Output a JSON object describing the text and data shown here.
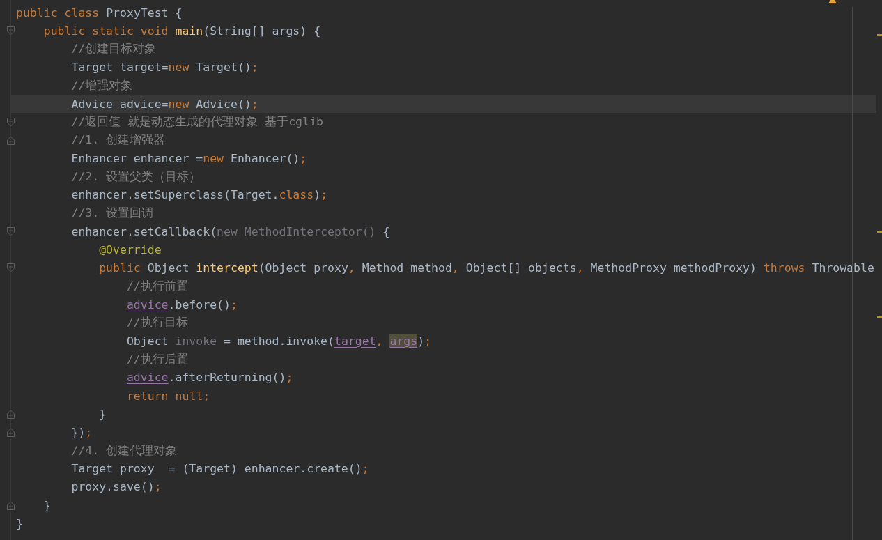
{
  "editor": {
    "lines": [
      {
        "kind": "line",
        "current": false,
        "tokens": [
          {
            "kind": "keyword",
            "text": "public class "
          },
          {
            "kind": "plain",
            "text": "ProxyTest {"
          }
        ],
        "children": [
          {
            "kind": "fold_start",
            "current": false,
            "tokens": [
              {
                "kind": "keyword",
                "text": "public static void "
              },
              {
                "kind": "method",
                "text": "main"
              },
              {
                "kind": "plain",
                "text": "(String[] args) {"
              }
            ],
            "children": [
              {
                "kind": "line",
                "current": false,
                "tokens": [
                  {
                    "kind": "comment",
                    "text": "//创建目标对象"
                  }
                ]
              },
              {
                "kind": "line",
                "current": false,
                "tokens": [
                  {
                    "kind": "plain",
                    "text": "Target target="
                  },
                  {
                    "kind": "keyword",
                    "text": "new "
                  },
                  {
                    "kind": "plain",
                    "text": "Target()"
                  },
                  {
                    "kind": "keyword",
                    "text": ";"
                  }
                ]
              },
              {
                "kind": "line",
                "current": false,
                "tokens": [
                  {
                    "kind": "comment",
                    "text": "//增强对象"
                  }
                ]
              },
              {
                "kind": "line",
                "current": true,
                "tokens": [
                  {
                    "kind": "plain",
                    "text": "Advice advice="
                  },
                  {
                    "kind": "keyword",
                    "text": "new "
                  },
                  {
                    "kind": "plain",
                    "text": "Advice()"
                  },
                  {
                    "kind": "keyword",
                    "text": ";"
                  }
                ]
              },
              {
                "kind": "fold_start",
                "current": false,
                "tokens": [
                  {
                    "kind": "comment",
                    "text": "//返回值 就是动态生成的代理对象 基于cglib"
                  }
                ]
              },
              {
                "kind": "fold_end",
                "current": false,
                "tokens": [
                  {
                    "kind": "comment",
                    "text": "//1. 创建增强器"
                  }
                ]
              },
              {
                "kind": "line",
                "current": false,
                "tokens": [
                  {
                    "kind": "plain",
                    "text": "Enhancer enhancer ="
                  },
                  {
                    "kind": "keyword",
                    "text": "new "
                  },
                  {
                    "kind": "plain",
                    "text": "Enhancer()"
                  },
                  {
                    "kind": "keyword",
                    "text": ";"
                  }
                ]
              },
              {
                "kind": "line",
                "current": false,
                "tokens": [
                  {
                    "kind": "comment",
                    "text": "//2. 设置父类（目标）"
                  }
                ]
              },
              {
                "kind": "line",
                "current": false,
                "tokens": [
                  {
                    "kind": "plain",
                    "text": "enhancer.setSuperclass(Target."
                  },
                  {
                    "kind": "keyword",
                    "text": "class"
                  },
                  {
                    "kind": "plain",
                    "text": ")"
                  },
                  {
                    "kind": "keyword",
                    "text": ";"
                  }
                ]
              },
              {
                "kind": "line",
                "current": false,
                "tokens": [
                  {
                    "kind": "comment",
                    "text": "//3. 设置回调"
                  }
                ]
              },
              {
                "kind": "fold_start",
                "current": false,
                "tokens": [
                  {
                    "kind": "plain",
                    "text": "enhancer.setCallback("
                  },
                  {
                    "kind": "unused",
                    "text": "new MethodInterceptor()"
                  },
                  {
                    "kind": "plain",
                    "text": " {"
                  }
                ],
                "children": [
                  {
                    "kind": "line",
                    "current": false,
                    "tokens": [
                      {
                        "kind": "annotation",
                        "text": "@Override"
                      }
                    ]
                  },
                  {
                    "kind": "fold_start",
                    "current": false,
                    "tokens": [
                      {
                        "kind": "keyword",
                        "text": "public "
                      },
                      {
                        "kind": "plain",
                        "text": "Object "
                      },
                      {
                        "kind": "method",
                        "text": "intercept"
                      },
                      {
                        "kind": "plain",
                        "text": "(Object proxy"
                      },
                      {
                        "kind": "keyword",
                        "text": ", "
                      },
                      {
                        "kind": "plain",
                        "text": "Method method"
                      },
                      {
                        "kind": "keyword",
                        "text": ", "
                      },
                      {
                        "kind": "plain",
                        "text": "Object[] objects"
                      },
                      {
                        "kind": "keyword",
                        "text": ", "
                      },
                      {
                        "kind": "plain",
                        "text": "MethodProxy methodProxy) "
                      },
                      {
                        "kind": "keyword",
                        "text": "throws "
                      },
                      {
                        "kind": "plain",
                        "text": "Throwable"
                      }
                    ],
                    "children": [
                      {
                        "kind": "line",
                        "current": false,
                        "tokens": [
                          {
                            "kind": "comment",
                            "text": "//执行前置"
                          }
                        ]
                      },
                      {
                        "kind": "line",
                        "current": false,
                        "tokens": [
                          {
                            "kind": "field",
                            "text": "advice"
                          },
                          {
                            "kind": "plain",
                            "text": ".before()"
                          },
                          {
                            "kind": "keyword",
                            "text": ";"
                          }
                        ]
                      },
                      {
                        "kind": "line",
                        "current": false,
                        "tokens": [
                          {
                            "kind": "comment",
                            "text": "//执行目标"
                          }
                        ]
                      },
                      {
                        "kind": "line",
                        "current": false,
                        "tokens": [
                          {
                            "kind": "plain",
                            "text": "Object "
                          },
                          {
                            "kind": "unused",
                            "text": "invoke"
                          },
                          {
                            "kind": "plain",
                            "text": " = method.invoke("
                          },
                          {
                            "kind": "field",
                            "text": "target"
                          },
                          {
                            "kind": "keyword",
                            "text": ", "
                          },
                          {
                            "kind": "field_highlight",
                            "text": "args"
                          },
                          {
                            "kind": "plain",
                            "text": ")"
                          },
                          {
                            "kind": "keyword",
                            "text": ";"
                          }
                        ]
                      },
                      {
                        "kind": "line",
                        "current": false,
                        "tokens": [
                          {
                            "kind": "comment",
                            "text": "//执行后置"
                          }
                        ]
                      },
                      {
                        "kind": "line",
                        "current": false,
                        "tokens": [
                          {
                            "kind": "field",
                            "text": "advice"
                          },
                          {
                            "kind": "plain",
                            "text": ".afterReturning()"
                          },
                          {
                            "kind": "keyword",
                            "text": ";"
                          }
                        ]
                      },
                      {
                        "kind": "line",
                        "current": false,
                        "tokens": [
                          {
                            "kind": "keyword",
                            "text": "return null;"
                          }
                        ]
                      }
                    ]
                  },
                  {
                    "kind": "fold_end",
                    "current": false,
                    "tokens": [
                      {
                        "kind": "plain",
                        "text": "}"
                      }
                    ]
                  }
                ]
              },
              {
                "kind": "fold_end",
                "current": false,
                "tokens": [
                  {
                    "kind": "plain",
                    "text": "})"
                  },
                  {
                    "kind": "keyword",
                    "text": ";"
                  }
                ]
              },
              {
                "kind": "line",
                "current": false,
                "tokens": [
                  {
                    "kind": "comment",
                    "text": "//4. 创建代理对象"
                  }
                ]
              },
              {
                "kind": "line",
                "current": false,
                "tokens": [
                  {
                    "kind": "plain",
                    "text": "Target proxy  = (Target) enhancer.create()"
                  },
                  {
                    "kind": "keyword",
                    "text": ";"
                  }
                ]
              },
              {
                "kind": "line",
                "current": false,
                "tokens": [
                  {
                    "kind": "plain",
                    "text": "proxy.save()"
                  },
                  {
                    "kind": "keyword",
                    "text": ";"
                  }
                ]
              }
            ]
          },
          {
            "kind": "fold_end",
            "current": false,
            "tokens": [
              {
                "kind": "plain",
                "text": "}"
              }
            ]
          }
        ]
      },
      {
        "kind": "line",
        "current": false,
        "tokens": [
          {
            "kind": "plain",
            "text": "}"
          }
        ]
      }
    ]
  }
}
